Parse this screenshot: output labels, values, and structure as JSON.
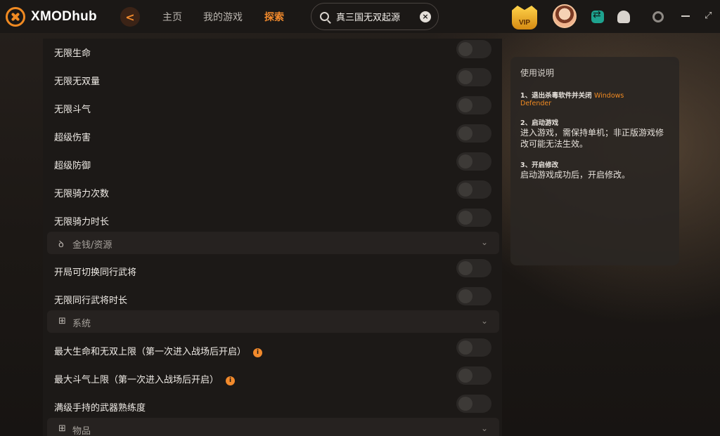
{
  "app": {
    "name": "XMODhub"
  },
  "nav": {
    "back": "<",
    "home": "主页",
    "my_games": "我的游戏",
    "explore": "探索"
  },
  "search": {
    "value": "真三国无双起源",
    "clear": "×"
  },
  "vip": {
    "label": "VIP"
  },
  "window": {
    "maximize": "⤢"
  },
  "accent_color": "#f28a2c",
  "cheats_group_a": [
    {
      "label": "无限生命",
      "enabled": false
    },
    {
      "label": "无限无双量",
      "enabled": false
    },
    {
      "label": "无限斗气",
      "enabled": false
    },
    {
      "label": "超级伤害",
      "enabled": false
    },
    {
      "label": "超级防御",
      "enabled": false
    },
    {
      "label": "无限骑力次数",
      "enabled": false
    },
    {
      "label": "无限骑力时长",
      "enabled": false
    }
  ],
  "section_money": {
    "label": "金钱/资源",
    "icon": "money-bag-icon"
  },
  "cheats_group_b": [
    {
      "label": "开局可切换同行武将",
      "enabled": false
    },
    {
      "label": "无限同行武将时长",
      "enabled": false
    }
  ],
  "section_system": {
    "label": "系统",
    "icon": "grid-icon"
  },
  "cheats_group_c": [
    {
      "label": "最大生命和无双上限（第一次进入战场后开启）",
      "enabled": false,
      "info": "i"
    },
    {
      "label": "最大斗气上限（第一次进入战场后开启）",
      "enabled": false,
      "info": "i"
    },
    {
      "label": "满级手持的武器熟练度",
      "enabled": false
    }
  ],
  "section_items": {
    "label": "物品",
    "icon": "plus-box-icon"
  },
  "help": {
    "title": "使用说明",
    "step1_head": "1、退出杀毒软件并关闭",
    "step1_highlight": "Windows",
    "step1_highlight2": "Defender",
    "step2_head": "2、启动游戏",
    "step2_body": "进入游戏，需保持单机；非正版游戏修改可能无法生效。",
    "step3_head": "3、开启修改",
    "step3_body": "启动游戏成功后，开启修改。"
  }
}
